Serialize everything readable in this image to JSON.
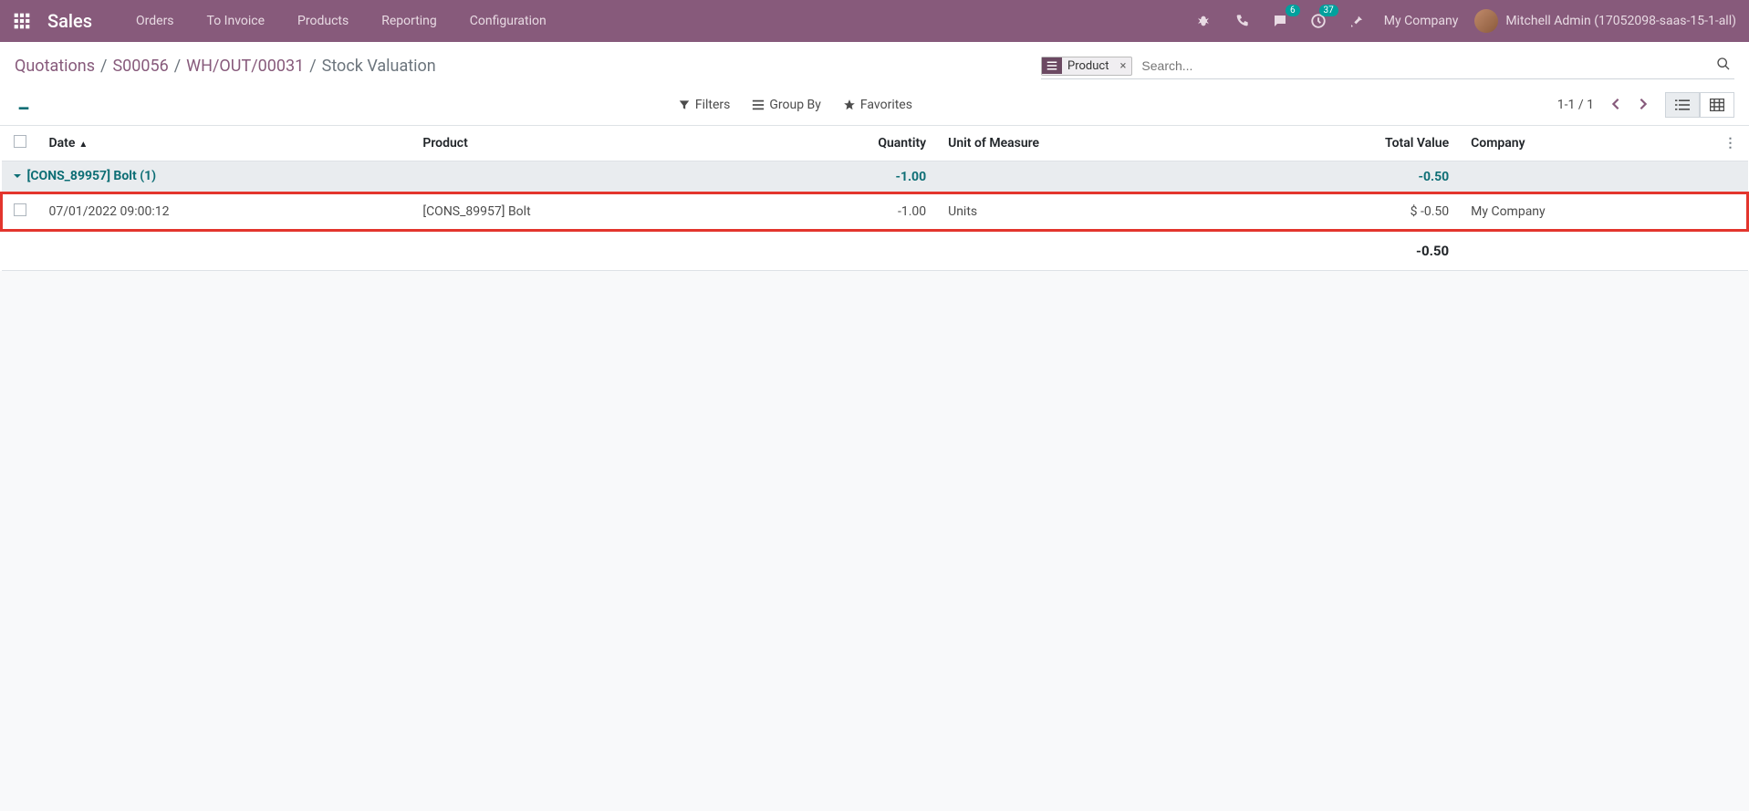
{
  "navbar": {
    "app_title": "Sales",
    "menu": [
      "Orders",
      "To Invoice",
      "Products",
      "Reporting",
      "Configuration"
    ],
    "messages_badge": "6",
    "activities_badge": "37",
    "company": "My Company",
    "user": "Mitchell Admin (17052098-saas-15-1-all)"
  },
  "breadcrumb": {
    "items": [
      "Quotations",
      "S00056",
      "WH/OUT/00031"
    ],
    "current": "Stock Valuation"
  },
  "search": {
    "facet_label": "Product",
    "placeholder": "Search..."
  },
  "toolbar": {
    "filters": "Filters",
    "group_by": "Group By",
    "favorites": "Favorites",
    "pager": "1-1 / 1"
  },
  "table": {
    "headers": {
      "date": "Date",
      "product": "Product",
      "quantity": "Quantity",
      "uom": "Unit of Measure",
      "total_value": "Total Value",
      "company": "Company"
    },
    "group": {
      "label": "[CONS_89957] Bolt (1)",
      "quantity": "-1.00",
      "total_value": "-0.50"
    },
    "row": {
      "date": "07/01/2022 09:00:12",
      "product": "[CONS_89957] Bolt",
      "quantity": "-1.00",
      "uom": "Units",
      "total_value": "$ -0.50",
      "company": "My Company"
    },
    "total": "-0.50"
  }
}
